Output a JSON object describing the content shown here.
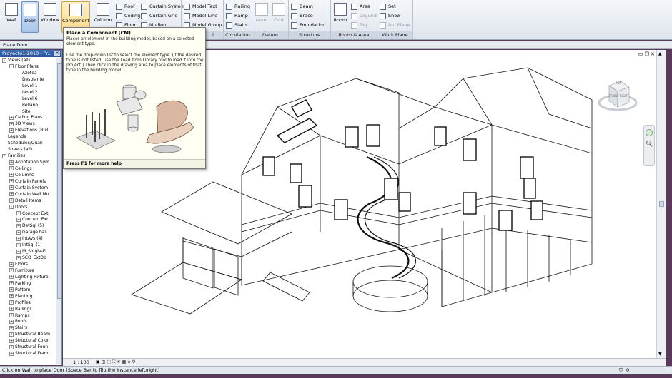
{
  "ribbon": {
    "big_buttons": [
      {
        "id": "wall",
        "label": "Wall"
      },
      {
        "id": "door",
        "label": "Door"
      },
      {
        "id": "window",
        "label": "Window"
      },
      {
        "id": "component",
        "label": "Component"
      },
      {
        "id": "column",
        "label": "Column"
      }
    ],
    "build_small": [
      "Roof",
      "Ceiling",
      "Floor",
      "Curtain System",
      "Curtain Grid",
      "Mullion"
    ],
    "model_small": [
      "Model Text",
      "Model Line",
      "Model Group"
    ],
    "circulation_small": [
      "Railing",
      "Ramp",
      "Stairs"
    ],
    "datum_buttons": [
      "Level",
      "Grid"
    ],
    "structure_small": [
      "Beam",
      "Brace",
      "Foundation"
    ],
    "room_button": "Room",
    "room_small": [
      "Area",
      "Legend",
      "Tag"
    ],
    "workplane_small": [
      "Set",
      "Show",
      "Ref Plane"
    ],
    "panel_labels": [
      "l",
      "Circulation",
      "Datum",
      "Structure",
      "Room & Area",
      "Work Plane"
    ]
  },
  "options_bar": {
    "text": "Place Door"
  },
  "browser": {
    "title": "Proyecto1-2010 - Pr...",
    "close": "×",
    "items": [
      {
        "label": "Views (all)",
        "level": 0,
        "ex": "-"
      },
      {
        "label": "Floor Plans",
        "level": 1,
        "ex": "-"
      },
      {
        "label": "Azotea",
        "level": 2,
        "ex": ""
      },
      {
        "label": "Desplante",
        "level": 2,
        "ex": ""
      },
      {
        "label": "Level 1",
        "level": 2,
        "ex": ""
      },
      {
        "label": "Level 2",
        "level": 2,
        "ex": ""
      },
      {
        "label": "Level 6",
        "level": 2,
        "ex": ""
      },
      {
        "label": "Rellano",
        "level": 2,
        "ex": ""
      },
      {
        "label": "Site",
        "level": 2,
        "ex": ""
      },
      {
        "label": "Ceiling Plans",
        "level": 1,
        "ex": "+"
      },
      {
        "label": "3D Views",
        "level": 1,
        "ex": "+"
      },
      {
        "label": "Elevations (Buil",
        "level": 1,
        "ex": "+"
      },
      {
        "label": "Legends",
        "level": 0,
        "ex": ""
      },
      {
        "label": "Schedules/Quan",
        "level": 0,
        "ex": ""
      },
      {
        "label": "Sheets (all)",
        "level": 0,
        "ex": ""
      },
      {
        "label": "Families",
        "level": 0,
        "ex": "-"
      },
      {
        "label": "Annotation Sym",
        "level": 1,
        "ex": "+"
      },
      {
        "label": "Ceilings",
        "level": 1,
        "ex": "+"
      },
      {
        "label": "Columns",
        "level": 1,
        "ex": "+"
      },
      {
        "label": "Curtain Panels",
        "level": 1,
        "ex": "+"
      },
      {
        "label": "Curtain System",
        "level": 1,
        "ex": "+"
      },
      {
        "label": "Curtain Wall Mu",
        "level": 1,
        "ex": "+"
      },
      {
        "label": "Detail Items",
        "level": 1,
        "ex": "+"
      },
      {
        "label": "Doors",
        "level": 1,
        "ex": "-"
      },
      {
        "label": "Concept Ext",
        "level": 2,
        "ex": "+"
      },
      {
        "label": "Concept Ext",
        "level": 2,
        "ex": "+"
      },
      {
        "label": "DetSgl (5)",
        "level": 2,
        "ex": "+"
      },
      {
        "label": "Garage bas",
        "level": 2,
        "ex": "+"
      },
      {
        "label": "IntAys (4)",
        "level": 2,
        "ex": "+"
      },
      {
        "label": "IntSgl (1)",
        "level": 2,
        "ex": "+"
      },
      {
        "label": "M_Single-Fl",
        "level": 2,
        "ex": "+"
      },
      {
        "label": "SCO_ExtDb",
        "level": 2,
        "ex": "+"
      },
      {
        "label": "Floors",
        "level": 1,
        "ex": "+"
      },
      {
        "label": "Furniture",
        "level": 1,
        "ex": "+"
      },
      {
        "label": "Lighting Fixture",
        "level": 1,
        "ex": "+"
      },
      {
        "label": "Parking",
        "level": 1,
        "ex": "+"
      },
      {
        "label": "Pattern",
        "level": 1,
        "ex": "+"
      },
      {
        "label": "Planting",
        "level": 1,
        "ex": "+"
      },
      {
        "label": "Profiles",
        "level": 1,
        "ex": "+"
      },
      {
        "label": "Railings",
        "level": 1,
        "ex": "+"
      },
      {
        "label": "Ramps",
        "level": 1,
        "ex": "+"
      },
      {
        "label": "Roofs",
        "level": 1,
        "ex": "+"
      },
      {
        "label": "Stairs",
        "level": 1,
        "ex": "+"
      },
      {
        "label": "Structural Beam",
        "level": 1,
        "ex": "+"
      },
      {
        "label": "Structural Colur",
        "level": 1,
        "ex": "+"
      },
      {
        "label": "Structural Foun",
        "level": 1,
        "ex": "+"
      },
      {
        "label": "Structural Frami",
        "level": 1,
        "ex": "+"
      }
    ]
  },
  "tooltip": {
    "title": "Place a Component (CM)",
    "desc1": "Places an element in the building model, based on a selected element type.",
    "desc2": "Use the drop-down list to select the element type. (If the desired type is not listed, use the Load from Library tool to load it into the project.) Then click in the drawing area to place elements of that type in the building model.",
    "footer": "Press F1 for more help"
  },
  "viewcube": {
    "face_top": "TOP",
    "face_front": "FRONT",
    "face_right": "RIGHT"
  },
  "viewbar": {
    "scale": "1 : 100"
  },
  "status": {
    "text": "Click on Wall to place Door (Space Bar to flip the instance left/right)",
    "filter_count": "0"
  }
}
